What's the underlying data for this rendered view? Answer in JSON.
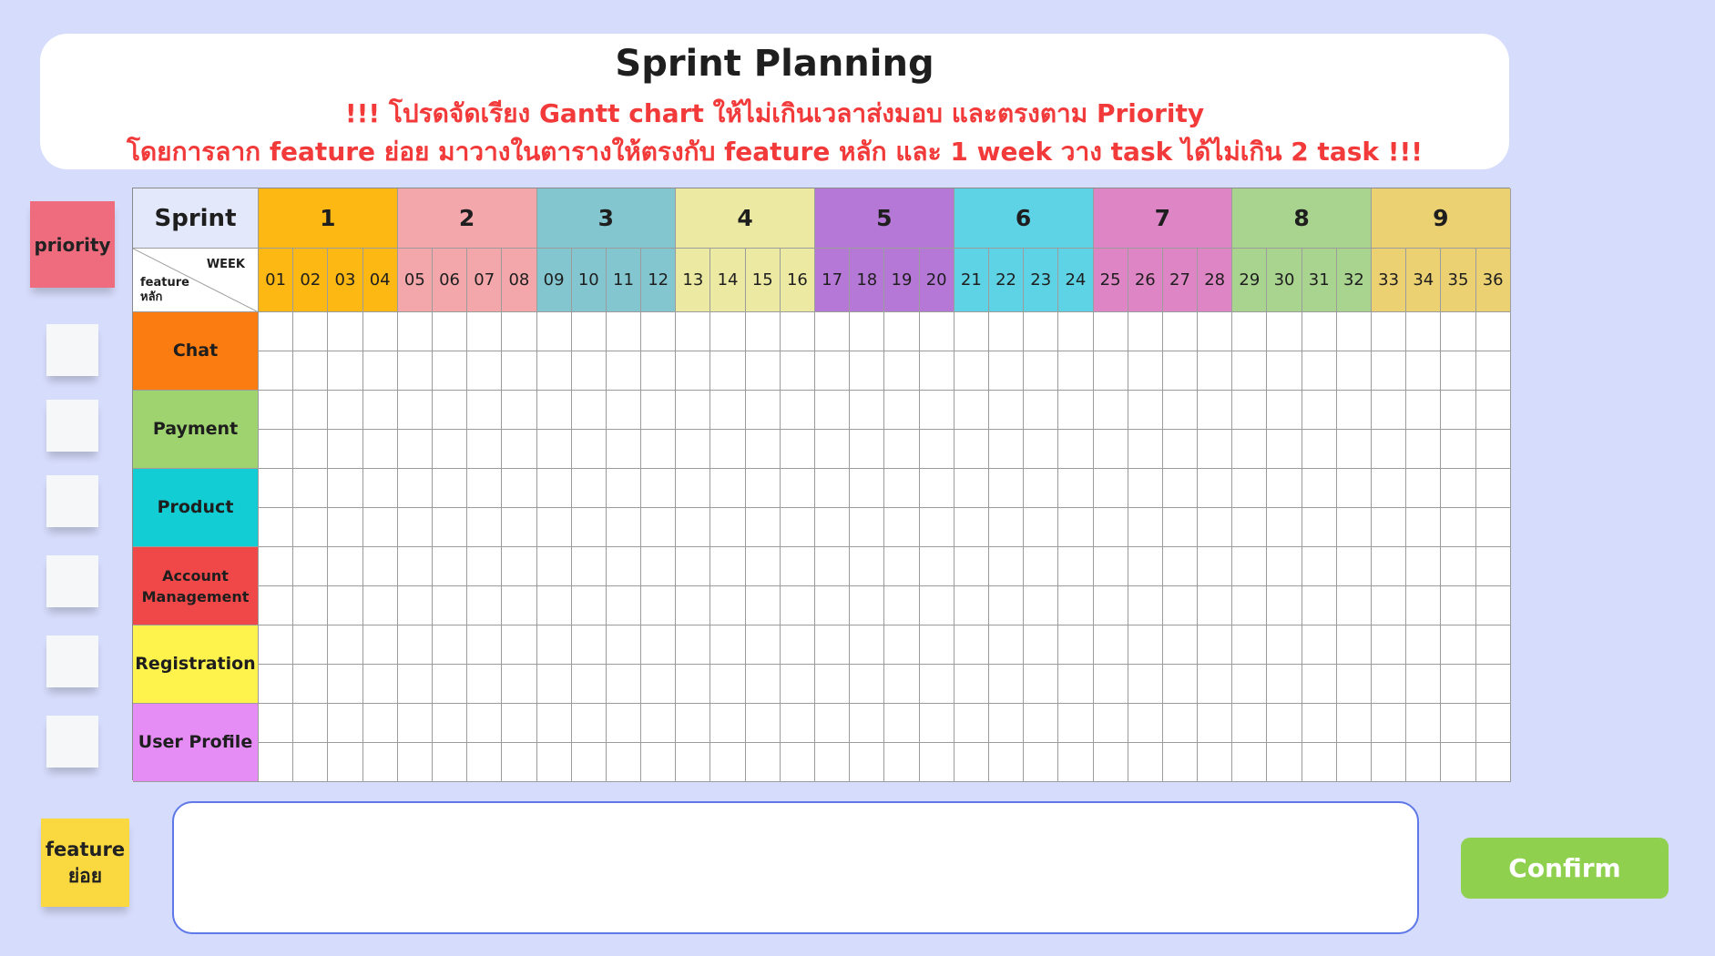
{
  "header": {
    "title": "Sprint Planning",
    "instruction_line1": "!!! โปรดจัดเรียง Gantt chart ให้ไม่เกินเวลาส่งมอบ และตรงตาม Priority",
    "instruction_line2": "โดยการลาก feature ย่อย มาวางในตารางให้ตรงกับ feature หลัก และ 1 week วาง task ได้ไม่เกิน 2  task !!!"
  },
  "priority_label": "priority",
  "feature_sub_label": "feature\nย่อย",
  "table": {
    "sprint_label": "Sprint",
    "corner_week": "WEEK",
    "corner_feature": "feature\nหลัก",
    "sprints": [
      {
        "label": "1",
        "color": "#fdb813"
      },
      {
        "label": "2",
        "color": "#f3a7aa"
      },
      {
        "label": "3",
        "color": "#83c6cf"
      },
      {
        "label": "4",
        "color": "#ece9a2"
      },
      {
        "label": "5",
        "color": "#b678d6"
      },
      {
        "label": "6",
        "color": "#5fd3e6"
      },
      {
        "label": "7",
        "color": "#de86c5"
      },
      {
        "label": "8",
        "color": "#a9d490"
      },
      {
        "label": "9",
        "color": "#ecd173"
      }
    ],
    "weeks": [
      "01",
      "02",
      "03",
      "04",
      "05",
      "06",
      "07",
      "08",
      "09",
      "10",
      "11",
      "12",
      "13",
      "14",
      "15",
      "16",
      "17",
      "18",
      "19",
      "20",
      "21",
      "22",
      "23",
      "24",
      "25",
      "26",
      "27",
      "28",
      "29",
      "30",
      "31",
      "32",
      "33",
      "34",
      "35",
      "36"
    ],
    "features": [
      {
        "label": "Chat",
        "color": "#fb7c10"
      },
      {
        "label": "Payment",
        "color": "#9ed36f"
      },
      {
        "label": "Product",
        "color": "#12cdd4"
      },
      {
        "label": "Account\nManagement",
        "color": "#f04848"
      },
      {
        "label": "Registration",
        "color": "#fdf34c"
      },
      {
        "label": "User Profile",
        "color": "#e58df5"
      }
    ]
  },
  "confirm_label": "Confirm"
}
